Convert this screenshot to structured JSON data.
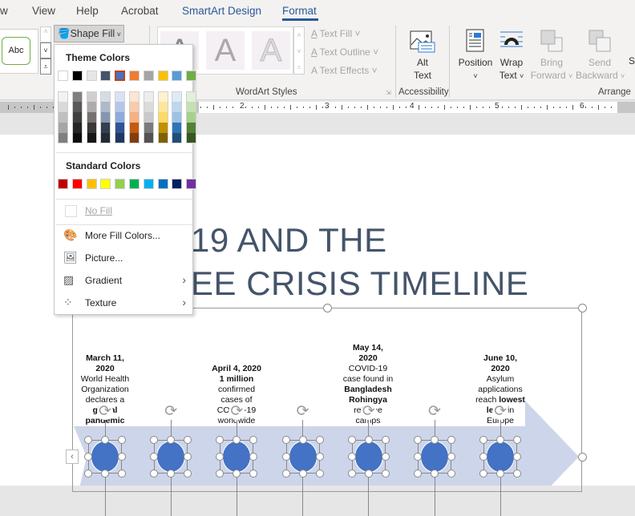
{
  "tabs": [
    {
      "label": "w"
    },
    {
      "label": "View"
    },
    {
      "label": "Help"
    },
    {
      "label": "Acrobat"
    },
    {
      "label": "SmartArt Design",
      "contextual": true
    },
    {
      "label": "Format",
      "contextual": true,
      "active": true
    }
  ],
  "ribbon": {
    "shape_style_sample": "Abc",
    "shape_fill_label": "Shape Fill",
    "wordart_sample": "A",
    "text_fill": "Text Fill",
    "text_outline": "Text Outline",
    "text_effects": "Text Effects",
    "wordart_group": "WordArt Styles",
    "alt_text": [
      "Alt",
      "Text"
    ],
    "accessibility_group": "Accessibility",
    "position": "Position",
    "wrap_text": [
      "Wrap",
      "Text"
    ],
    "bring_forward": [
      "Bring",
      "Forward"
    ],
    "send_backward": [
      "Send",
      "Backward"
    ],
    "selection_pane_partial": "S",
    "arrange_group": "Arrange"
  },
  "ruler": {
    "labels": [
      "2",
      "3",
      "4",
      "5",
      "6"
    ]
  },
  "shape_fill_menu": {
    "theme_colors_label": "Theme Colors",
    "theme_colors": [
      "#ffffff",
      "#000000",
      "#e7e6e6",
      "#44546a",
      "#4472c4",
      "#ed7d31",
      "#a5a5a5",
      "#ffc000",
      "#5b9bd5",
      "#70ad47"
    ],
    "selected_theme_color": "#4472c4",
    "theme_shades": [
      [
        "#f2f2f2",
        "#d9d9d9",
        "#bfbfbf",
        "#a6a6a6",
        "#808080"
      ],
      [
        "#7f7f7f",
        "#595959",
        "#404040",
        "#262626",
        "#0d0d0d"
      ],
      [
        "#d0cece",
        "#aeabab",
        "#757171",
        "#3b3838",
        "#171717"
      ],
      [
        "#d6dce4",
        "#adb9ca",
        "#8496b0",
        "#333f4f",
        "#222a35"
      ],
      [
        "#d9e2f3",
        "#b4c6e7",
        "#8eaadb",
        "#2f5496",
        "#1f3864"
      ],
      [
        "#fbe5d5",
        "#f7cbac",
        "#f4b183",
        "#c55a11",
        "#843c0c"
      ],
      [
        "#ededed",
        "#dbdbdb",
        "#c9c9c9",
        "#7b7b7b",
        "#525252"
      ],
      [
        "#fff2cc",
        "#fee599",
        "#ffd965",
        "#bf9000",
        "#7f6000"
      ],
      [
        "#deebf6",
        "#bdd7ee",
        "#9cc3e5",
        "#2e75b5",
        "#1f4e79"
      ],
      [
        "#e2efd9",
        "#c5e0b3",
        "#a8d08d",
        "#538135",
        "#375623"
      ]
    ],
    "standard_colors_label": "Standard Colors",
    "standard_colors": [
      "#c00000",
      "#ff0000",
      "#ffc000",
      "#ffff00",
      "#92d050",
      "#00b050",
      "#00b0f0",
      "#0070c0",
      "#002060",
      "#7030a0"
    ],
    "no_fill": "No Fill",
    "items": [
      {
        "label": "More Fill Colors...",
        "icon": "palette-icon"
      },
      {
        "label": "Picture...",
        "icon": "picture-icon"
      },
      {
        "label": "Gradient",
        "icon": "gradient-icon",
        "submenu": true
      },
      {
        "label": "Texture",
        "icon": "texture-icon",
        "submenu": true
      }
    ]
  },
  "document": {
    "title_line1": "19 AND THE",
    "title_line2": "EE CRISIS TIMELINE",
    "title_color": "#44546a",
    "arrow_color": "#cdd5ea",
    "node_color": "#4472c4",
    "events": [
      {
        "lines": [
          {
            "t": "March 11,",
            "b": true
          },
          {
            "t": "2020",
            "b": true
          },
          {
            "t": "World Health"
          },
          {
            "t": "Organization"
          },
          {
            "t": "declares a"
          },
          {
            "t": "global",
            "b": true
          },
          {
            "t": "pandemic",
            "b": true
          }
        ]
      },
      {
        "lines": [
          {
            "t": "April 4, 2020",
            "b": true
          },
          {
            "t": "1 million",
            "b": true
          },
          {
            "t": "confirmed"
          },
          {
            "t": "cases of"
          },
          {
            "t": "COVID-19"
          },
          {
            "t": "worldwide"
          }
        ]
      },
      {
        "lines": [
          {
            "t": "May 14,",
            "b": true
          },
          {
            "t": "2020",
            "b": true
          },
          {
            "t": "COVID-19"
          },
          {
            "t": "case found in"
          },
          {
            "t": "Bangladesh",
            "b": true
          },
          {
            "t": "Rohingya",
            "b": true
          },
          {
            "t": "refugee"
          },
          {
            "t": "camps"
          }
        ]
      },
      {
        "lines": [
          {
            "t": "June 10,",
            "b": true
          },
          {
            "t": "2020",
            "b": true
          },
          {
            "t": "Asylum"
          },
          {
            "t": "applications"
          },
          {
            "t": "reach ",
            "b2": "lowest"
          },
          {
            "t": "",
            "b2": "level",
            "t2": " in"
          },
          {
            "t": "Europe"
          }
        ]
      }
    ],
    "node_count": 7
  }
}
